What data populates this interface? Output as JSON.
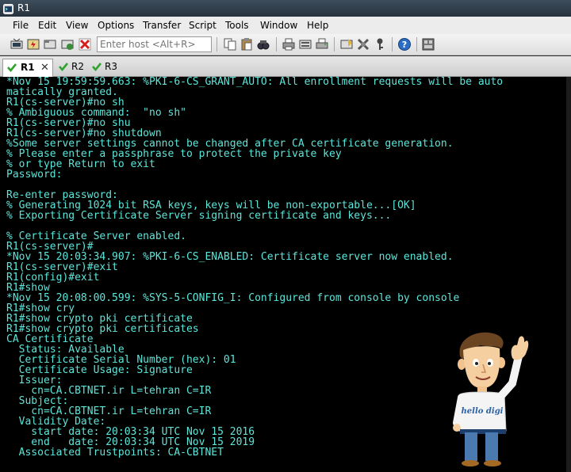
{
  "window": {
    "title": "R1"
  },
  "menu": [
    "File",
    "Edit",
    "View",
    "Options",
    "Transfer",
    "Script",
    "Tools",
    "Window",
    "Help"
  ],
  "toolbar": {
    "host_placeholder": "Enter host <Alt+R>"
  },
  "tabs": [
    {
      "label": "R1",
      "active": true
    },
    {
      "label": "R2",
      "active": false
    },
    {
      "label": "R3",
      "active": false
    }
  ],
  "terminal": {
    "lines": [
      "*Nov 15 19:59:59.663: %PKI-6-CS_GRANT_AUTO: All enrollment requests will be auto",
      "matically granted.",
      "R1(cs-server)#no sh",
      "% Ambiguous command:  \"no sh\"",
      "R1(cs-server)#no shu",
      "R1(cs-server)#no shutdown",
      "%Some server settings cannot be changed after CA certificate generation.",
      "% Please enter a passphrase to protect the private key",
      "% or type Return to exit",
      "Password:",
      "",
      "Re-enter password:",
      "% Generating 1024 bit RSA keys, keys will be non-exportable...[OK]",
      "% Exporting Certificate Server signing certificate and keys...",
      "",
      "% Certificate Server enabled.",
      "R1(cs-server)#",
      "*Nov 15 20:03:34.907: %PKI-6-CS_ENABLED: Certificate server now enabled.",
      "R1(cs-server)#exit",
      "R1(config)#exit",
      "R1#show",
      "*Nov 15 20:08:00.599: %SYS-5-CONFIG_I: Configured from console by console",
      "R1#show cry",
      "R1#show crypto pki certificate",
      "R1#show crypto pki certificates",
      "CA Certificate",
      "  Status: Available",
      "  Certificate Serial Number (hex): 01",
      "  Certificate Usage: Signature",
      "  Issuer:",
      "    cn=CA.CBTNET.ir L=tehran C=IR",
      "  Subject:",
      "    cn=CA.CBTNET.ir L=tehran C=IR",
      "  Validity Date:",
      "    start date: 20:03:34 UTC Nov 15 2016",
      "    end   date: 20:03:34 UTC Nov 15 2019",
      "  Associated Trustpoints: CA-CBTNET"
    ]
  },
  "mascot": {
    "shirt_text": "hello digi"
  },
  "colors": {
    "terminal_fg": "#5ce6da",
    "terminal_bg": "#000000"
  }
}
